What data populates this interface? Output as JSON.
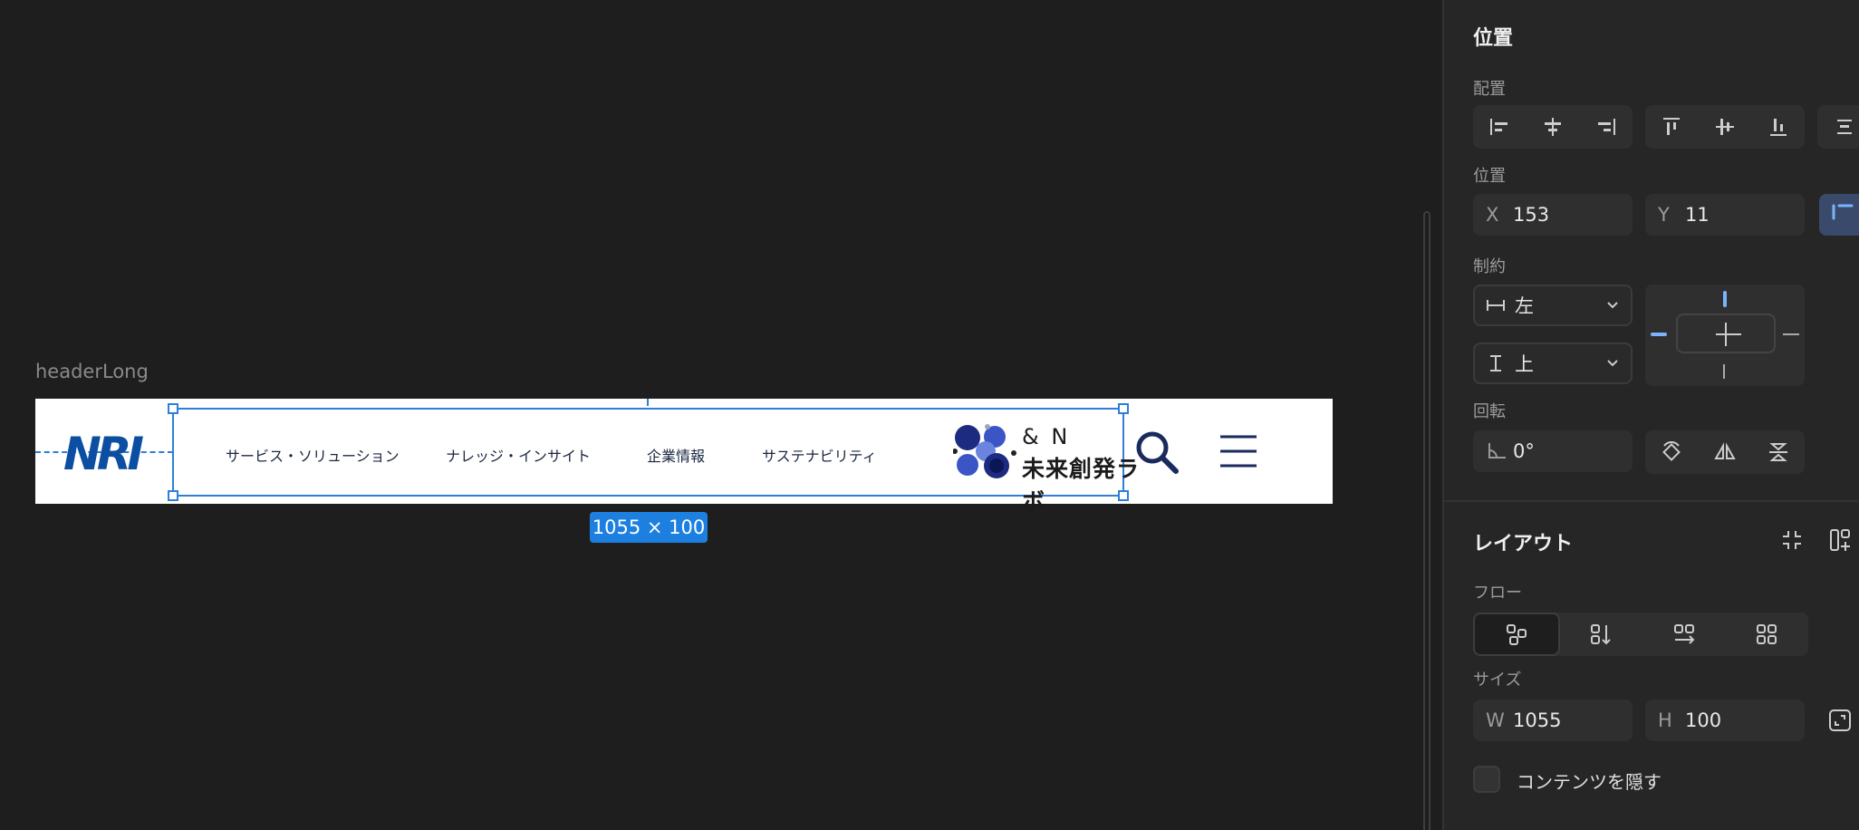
{
  "canvas": {
    "frame_label": "headerLong",
    "size_badge": "1055 × 100",
    "header": {
      "logo": "NRI",
      "nav": [
        "サービス・ソリューション",
        "ナレッジ・インサイト",
        "企業情報",
        "サステナビリティ"
      ],
      "brand_line1": "& N",
      "brand_line2": "未来創発ラボ"
    }
  },
  "panel": {
    "position_section_title": "位置",
    "align_label": "配置",
    "position_label": "位置",
    "x_prefix": "X",
    "x_value": "153",
    "y_prefix": "Y",
    "y_value": "11",
    "constraints_label": "制約",
    "horizontal_constraint": "左",
    "vertical_constraint": "上",
    "rotation_label": "回転",
    "rotation_value": "0°",
    "layout_section_title": "レイアウト",
    "flow_label": "フロー",
    "size_label": "サイズ",
    "w_prefix": "W",
    "w_value": "1055",
    "h_prefix": "H",
    "h_value": "100",
    "clip_content_label": "コンテンツを隠す"
  },
  "colors": {
    "accent": "#2f7fd8",
    "badge": "#1d7fe0",
    "nri_blue": "#0b4ea2",
    "panel_bg": "#262626"
  }
}
